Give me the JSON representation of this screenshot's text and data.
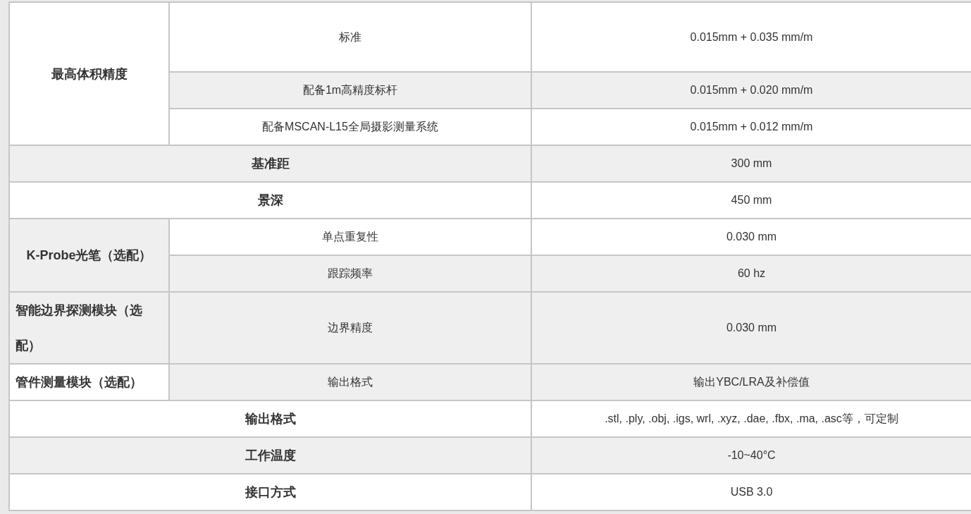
{
  "spec_table": {
    "rows": [
      {
        "cells": [
          {
            "text": "最高体积精度",
            "kind": "header",
            "rowspan": 3,
            "shaded": false
          },
          {
            "text": "标准",
            "kind": "sub",
            "shaded": false
          },
          {
            "text": "0.015mm + 0.035 mm/m",
            "kind": "value",
            "shaded": false
          }
        ]
      },
      {
        "cells": [
          {
            "text": "配备1m高精度标杆",
            "kind": "sub",
            "shaded": true
          },
          {
            "text": "0.015mm + 0.020 mm/m",
            "kind": "value",
            "shaded": true
          }
        ]
      },
      {
        "cells": [
          {
            "text": "配备MSCAN-L15全局摄影测量系统",
            "kind": "sub",
            "shaded": false
          },
          {
            "text": "0.015mm + 0.012 mm/m",
            "kind": "value",
            "shaded": false
          }
        ]
      },
      {
        "cells": [
          {
            "text": "基准距",
            "kind": "header",
            "colspan": 2,
            "shaded": true
          },
          {
            "text": "300 mm",
            "kind": "value",
            "shaded": true
          }
        ]
      },
      {
        "cells": [
          {
            "text": "景深",
            "kind": "header",
            "colspan": 2,
            "shaded": false
          },
          {
            "text": "450 mm",
            "kind": "value",
            "shaded": false
          }
        ]
      },
      {
        "cells": [
          {
            "text": "K-Probe光笔（选配）",
            "kind": "header",
            "rowspan": 2,
            "shaded": true
          },
          {
            "text": "单点重复性",
            "kind": "sub",
            "shaded": false
          },
          {
            "text": "0.030 mm",
            "kind": "value",
            "shaded": false
          }
        ]
      },
      {
        "cells": [
          {
            "text": "跟踪频率",
            "kind": "sub",
            "shaded": true
          },
          {
            "text": "60 hz",
            "kind": "value",
            "shaded": true
          }
        ]
      },
      {
        "cells": [
          {
            "text": "智能边界探测模块（选配）",
            "kind": "header",
            "shaded": true
          },
          {
            "text": "边界精度",
            "kind": "sub",
            "shaded": true
          },
          {
            "text": "0.030 mm",
            "kind": "value",
            "shaded": true
          }
        ]
      },
      {
        "cells": [
          {
            "text": "管件测量模块（选配）",
            "kind": "header",
            "shaded": false
          },
          {
            "text": "输出格式",
            "kind": "sub",
            "shaded": true
          },
          {
            "text": "输出YBC/LRA及补偿值",
            "kind": "value",
            "shaded": true
          }
        ]
      },
      {
        "cells": [
          {
            "text": "输出格式",
            "kind": "header",
            "colspan": 2,
            "shaded": false
          },
          {
            "text": ".stl, .ply, .obj, .igs, wrl, .xyz, .dae, .fbx, .ma, .asc等，可定制",
            "kind": "value",
            "shaded": false
          }
        ]
      },
      {
        "cells": [
          {
            "text": "工作温度",
            "kind": "header",
            "colspan": 2,
            "shaded": true
          },
          {
            "text": "-10~40°C",
            "kind": "value",
            "shaded": true
          }
        ]
      },
      {
        "cells": [
          {
            "text": "接口方式",
            "kind": "header",
            "colspan": 2,
            "shaded": false
          },
          {
            "text": "USB 3.0",
            "kind": "value",
            "shaded": false
          }
        ]
      }
    ]
  }
}
